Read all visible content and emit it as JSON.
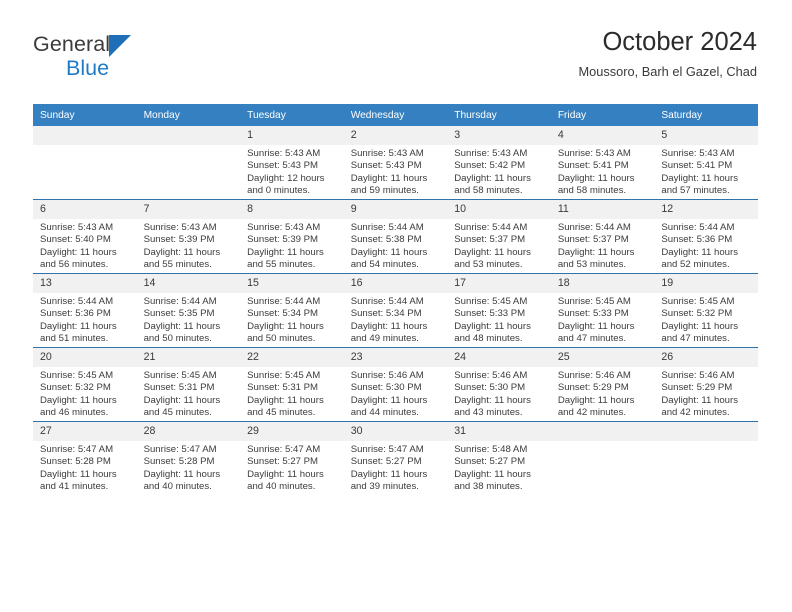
{
  "brand": {
    "name_top": "General",
    "name_bottom": "Blue",
    "color_dark": "#3b3b3b",
    "color_blue": "#1f7bc8"
  },
  "header": {
    "title": "October 2024",
    "subtitle": "Moussoro, Barh el Gazel, Chad"
  },
  "theme": {
    "header_bg": "#3580c0",
    "row_rule": "#2e72ae",
    "daynum_bg": "#f1f1f1"
  },
  "weekdays": [
    "Sunday",
    "Monday",
    "Tuesday",
    "Wednesday",
    "Thursday",
    "Friday",
    "Saturday"
  ],
  "weeks": [
    [
      {
        "day": "",
        "lines": [
          "",
          "",
          "",
          ""
        ]
      },
      {
        "day": "",
        "lines": [
          "",
          "",
          "",
          ""
        ]
      },
      {
        "day": "1",
        "lines": [
          "Sunrise: 5:43 AM",
          "Sunset: 5:43 PM",
          "Daylight: 12 hours",
          "and 0 minutes."
        ]
      },
      {
        "day": "2",
        "lines": [
          "Sunrise: 5:43 AM",
          "Sunset: 5:43 PM",
          "Daylight: 11 hours",
          "and 59 minutes."
        ]
      },
      {
        "day": "3",
        "lines": [
          "Sunrise: 5:43 AM",
          "Sunset: 5:42 PM",
          "Daylight: 11 hours",
          "and 58 minutes."
        ]
      },
      {
        "day": "4",
        "lines": [
          "Sunrise: 5:43 AM",
          "Sunset: 5:41 PM",
          "Daylight: 11 hours",
          "and 58 minutes."
        ]
      },
      {
        "day": "5",
        "lines": [
          "Sunrise: 5:43 AM",
          "Sunset: 5:41 PM",
          "Daylight: 11 hours",
          "and 57 minutes."
        ]
      }
    ],
    [
      {
        "day": "6",
        "lines": [
          "Sunrise: 5:43 AM",
          "Sunset: 5:40 PM",
          "Daylight: 11 hours",
          "and 56 minutes."
        ]
      },
      {
        "day": "7",
        "lines": [
          "Sunrise: 5:43 AM",
          "Sunset: 5:39 PM",
          "Daylight: 11 hours",
          "and 55 minutes."
        ]
      },
      {
        "day": "8",
        "lines": [
          "Sunrise: 5:43 AM",
          "Sunset: 5:39 PM",
          "Daylight: 11 hours",
          "and 55 minutes."
        ]
      },
      {
        "day": "9",
        "lines": [
          "Sunrise: 5:44 AM",
          "Sunset: 5:38 PM",
          "Daylight: 11 hours",
          "and 54 minutes."
        ]
      },
      {
        "day": "10",
        "lines": [
          "Sunrise: 5:44 AM",
          "Sunset: 5:37 PM",
          "Daylight: 11 hours",
          "and 53 minutes."
        ]
      },
      {
        "day": "11",
        "lines": [
          "Sunrise: 5:44 AM",
          "Sunset: 5:37 PM",
          "Daylight: 11 hours",
          "and 53 minutes."
        ]
      },
      {
        "day": "12",
        "lines": [
          "Sunrise: 5:44 AM",
          "Sunset: 5:36 PM",
          "Daylight: 11 hours",
          "and 52 minutes."
        ]
      }
    ],
    [
      {
        "day": "13",
        "lines": [
          "Sunrise: 5:44 AM",
          "Sunset: 5:36 PM",
          "Daylight: 11 hours",
          "and 51 minutes."
        ]
      },
      {
        "day": "14",
        "lines": [
          "Sunrise: 5:44 AM",
          "Sunset: 5:35 PM",
          "Daylight: 11 hours",
          "and 50 minutes."
        ]
      },
      {
        "day": "15",
        "lines": [
          "Sunrise: 5:44 AM",
          "Sunset: 5:34 PM",
          "Daylight: 11 hours",
          "and 50 minutes."
        ]
      },
      {
        "day": "16",
        "lines": [
          "Sunrise: 5:44 AM",
          "Sunset: 5:34 PM",
          "Daylight: 11 hours",
          "and 49 minutes."
        ]
      },
      {
        "day": "17",
        "lines": [
          "Sunrise: 5:45 AM",
          "Sunset: 5:33 PM",
          "Daylight: 11 hours",
          "and 48 minutes."
        ]
      },
      {
        "day": "18",
        "lines": [
          "Sunrise: 5:45 AM",
          "Sunset: 5:33 PM",
          "Daylight: 11 hours",
          "and 47 minutes."
        ]
      },
      {
        "day": "19",
        "lines": [
          "Sunrise: 5:45 AM",
          "Sunset: 5:32 PM",
          "Daylight: 11 hours",
          "and 47 minutes."
        ]
      }
    ],
    [
      {
        "day": "20",
        "lines": [
          "Sunrise: 5:45 AM",
          "Sunset: 5:32 PM",
          "Daylight: 11 hours",
          "and 46 minutes."
        ]
      },
      {
        "day": "21",
        "lines": [
          "Sunrise: 5:45 AM",
          "Sunset: 5:31 PM",
          "Daylight: 11 hours",
          "and 45 minutes."
        ]
      },
      {
        "day": "22",
        "lines": [
          "Sunrise: 5:45 AM",
          "Sunset: 5:31 PM",
          "Daylight: 11 hours",
          "and 45 minutes."
        ]
      },
      {
        "day": "23",
        "lines": [
          "Sunrise: 5:46 AM",
          "Sunset: 5:30 PM",
          "Daylight: 11 hours",
          "and 44 minutes."
        ]
      },
      {
        "day": "24",
        "lines": [
          "Sunrise: 5:46 AM",
          "Sunset: 5:30 PM",
          "Daylight: 11 hours",
          "and 43 minutes."
        ]
      },
      {
        "day": "25",
        "lines": [
          "Sunrise: 5:46 AM",
          "Sunset: 5:29 PM",
          "Daylight: 11 hours",
          "and 42 minutes."
        ]
      },
      {
        "day": "26",
        "lines": [
          "Sunrise: 5:46 AM",
          "Sunset: 5:29 PM",
          "Daylight: 11 hours",
          "and 42 minutes."
        ]
      }
    ],
    [
      {
        "day": "27",
        "lines": [
          "Sunrise: 5:47 AM",
          "Sunset: 5:28 PM",
          "Daylight: 11 hours",
          "and 41 minutes."
        ]
      },
      {
        "day": "28",
        "lines": [
          "Sunrise: 5:47 AM",
          "Sunset: 5:28 PM",
          "Daylight: 11 hours",
          "and 40 minutes."
        ]
      },
      {
        "day": "29",
        "lines": [
          "Sunrise: 5:47 AM",
          "Sunset: 5:27 PM",
          "Daylight: 11 hours",
          "and 40 minutes."
        ]
      },
      {
        "day": "30",
        "lines": [
          "Sunrise: 5:47 AM",
          "Sunset: 5:27 PM",
          "Daylight: 11 hours",
          "and 39 minutes."
        ]
      },
      {
        "day": "31",
        "lines": [
          "Sunrise: 5:48 AM",
          "Sunset: 5:27 PM",
          "Daylight: 11 hours",
          "and 38 minutes."
        ]
      },
      {
        "day": "",
        "lines": [
          "",
          "",
          "",
          ""
        ]
      },
      {
        "day": "",
        "lines": [
          "",
          "",
          "",
          ""
        ]
      }
    ]
  ]
}
